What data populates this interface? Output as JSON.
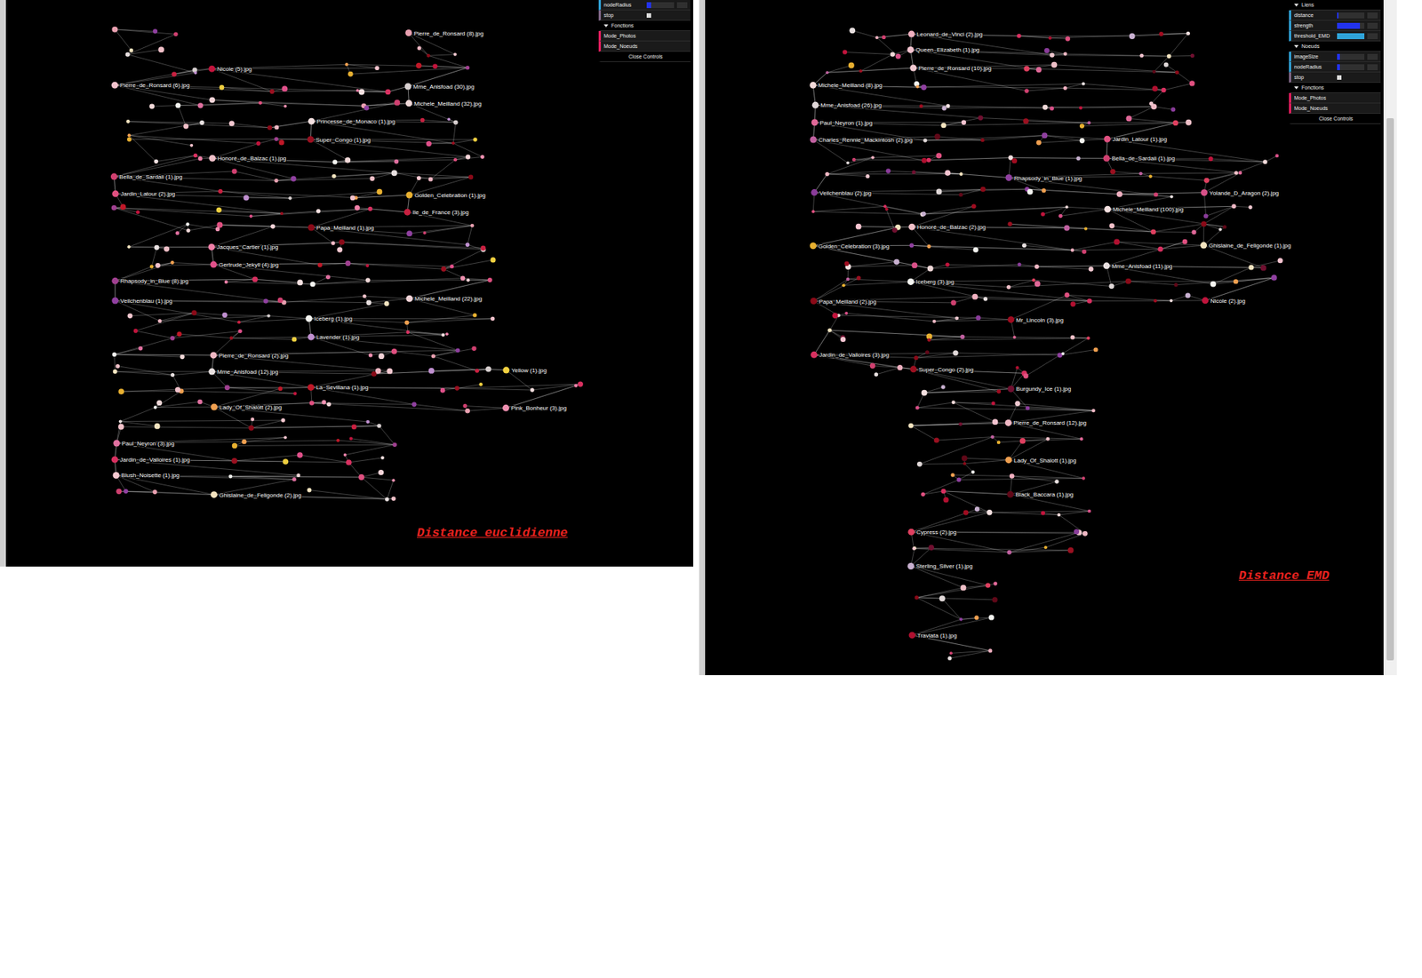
{
  "panels": [
    {
      "caption": "Distance euclidienne",
      "controls": [
        {
          "kind": "slider",
          "label": "nodeRadius",
          "level": 0.15,
          "color": "#2233ee"
        },
        {
          "kind": "checkbox",
          "label": "stop",
          "checked": false
        },
        {
          "kind": "folder",
          "label": "Fonctions",
          "expanded": true
        },
        {
          "kind": "button",
          "label": "Mode_Photos"
        },
        {
          "kind": "button",
          "label": "Mode_Noeuds"
        },
        {
          "kind": "close",
          "label": "Close Controls"
        }
      ],
      "scroll_level": null,
      "nodes": [
        {
          "label": "Pierre_de_Ronsard (8).jpg",
          "color": "#e9a0b0"
        },
        {
          "label": "Nicole (5).jpg",
          "color": "#c0143c"
        },
        {
          "label": "Pierre_de_Ronsard (6).jpg",
          "color": "#f2c2cc"
        },
        {
          "label": "Mme_Anisfoad (30).jpg",
          "color": "#d8d0d0"
        },
        {
          "label": "Michele_Meilland (32).jpg",
          "color": "#f0d8d8"
        },
        {
          "label": "Princesse_de_Monaco (1).jpg",
          "color": "#f4e0e0"
        },
        {
          "label": "Super_Congo (1).jpg",
          "color": "#9a1020"
        },
        {
          "label": "Honoré_de_Balzac (1).jpg",
          "color": "#f0c0c8"
        },
        {
          "label": "Bella_de_Sardaii (1).jpg",
          "color": "#d04070"
        },
        {
          "label": "Jardin_Latour (2).jpg",
          "color": "#e05080"
        },
        {
          "label": "Golden_Celebration (1).jpg",
          "color": "#e8b030"
        },
        {
          "label": "Ile_de_France (3).jpg",
          "color": "#c82040"
        },
        {
          "label": "Papa_Meilland (1).jpg",
          "color": "#8a0a18"
        },
        {
          "label": "Jacques_Cartier (1).jpg",
          "color": "#f080a8"
        },
        {
          "label": "Gertrude_Jekyll (4).jpg",
          "color": "#e0508a"
        },
        {
          "label": "Rhapsody_in_Blue (8).jpg",
          "color": "#a04090"
        },
        {
          "label": "Veilchenblau (1).jpg",
          "color": "#9040a0"
        },
        {
          "label": "Michele_Meilland (22).jpg",
          "color": "#f4d4d8"
        },
        {
          "label": "Iceberg (1).jpg",
          "color": "#f4f4f0"
        },
        {
          "label": "Lavender (1).jpg",
          "color": "#c090d0"
        },
        {
          "label": "Pierre_de_Ronsard (2).jpg",
          "color": "#f0b8c4"
        },
        {
          "label": "Mme_Anisfoad (12).jpg",
          "color": "#e8e0e0"
        },
        {
          "label": "Yellow (1).jpg",
          "color": "#f0d040"
        },
        {
          "label": "La_Sevillana (1).jpg",
          "color": "#c01828"
        },
        {
          "label": "Lady_Of_Shalott (2).jpg",
          "color": "#f0a050"
        },
        {
          "label": "Pink_Bonheur (3).jpg",
          "color": "#f090b0"
        },
        {
          "label": "Paul_Neyron (3).jpg",
          "color": "#e070a0"
        },
        {
          "label": "Jardin_de_Valloires (1).jpg",
          "color": "#d83060"
        },
        {
          "label": "Blush_Noisette (1).jpg",
          "color": "#f4c8d0"
        },
        {
          "label": "Ghislaine_de_Feligonde (2).jpg",
          "color": "#f4e4c0"
        }
      ]
    },
    {
      "caption": "Distance EMD",
      "controls": [
        {
          "kind": "folder",
          "label": "Liens",
          "expanded": true
        },
        {
          "kind": "slider",
          "label": "distance",
          "level": 0.05,
          "color": "#2233ee"
        },
        {
          "kind": "slider",
          "label": "strength",
          "level": 0.85,
          "color": "#2233ee"
        },
        {
          "kind": "slider",
          "label": "threshold_EMD",
          "level": 1.0,
          "color": "#2fa3d8"
        },
        {
          "kind": "folder",
          "label": "Noeuds",
          "expanded": true
        },
        {
          "kind": "slider",
          "label": "imageSize",
          "level": 0.12,
          "color": "#2233ee"
        },
        {
          "kind": "slider",
          "label": "nodeRadius",
          "level": 0.12,
          "color": "#2233ee"
        },
        {
          "kind": "checkbox",
          "label": "stop",
          "checked": false
        },
        {
          "kind": "folder",
          "label": "Fonctions",
          "expanded": true
        },
        {
          "kind": "button",
          "label": "Mode_Photos"
        },
        {
          "kind": "button",
          "label": "Mode_Noeuds"
        },
        {
          "kind": "close",
          "label": "Close Controls"
        }
      ],
      "scroll_level": 0.82,
      "nodes": [
        {
          "label": "Leonard_de_Vinci (2).jpg",
          "color": "#f0b0c0"
        },
        {
          "label": "Queen_Elizabeth (1).jpg",
          "color": "#f4c4d0"
        },
        {
          "label": "Pierre_de_Ronsard (10).jpg",
          "color": "#f0c8d0"
        },
        {
          "label": "Michele_Meilland (8).jpg",
          "color": "#f0d8d8"
        },
        {
          "label": "Mme_Anisfoad (26).jpg",
          "color": "#e0d8d8"
        },
        {
          "label": "Paul_Neyron (1).jpg",
          "color": "#e06898"
        },
        {
          "label": "Charles_Rennie_Mackintosh (2).jpg",
          "color": "#c060a0"
        },
        {
          "label": "Jardin_Latour (1).jpg",
          "color": "#e05080"
        },
        {
          "label": "Bella_de_Sardaii (1).jpg",
          "color": "#d04070"
        },
        {
          "label": "Rhapsody_in_Blue (1).jpg",
          "color": "#9040a0"
        },
        {
          "label": "Veilchenblau (2).jpg",
          "color": "#8a3c9a"
        },
        {
          "label": "Yolande_D_Aragon (2).jpg",
          "color": "#d85088"
        },
        {
          "label": "Michele_Meilland (100).jpg",
          "color": "#f4e0e0"
        },
        {
          "label": "Honoré_de_Balzac (2).jpg",
          "color": "#f0c0c8"
        },
        {
          "label": "Golden_Celebration (3).jpg",
          "color": "#e8b030"
        },
        {
          "label": "Ghislaine_de_Feligonde (1).jpg",
          "color": "#f4e4c0"
        },
        {
          "label": "Mme_Anisfoad (11).jpg",
          "color": "#e8e0e0"
        },
        {
          "label": "Iceberg (3).jpg",
          "color": "#f4f4f0"
        },
        {
          "label": "Papa_Meilland (2).jpg",
          "color": "#8a0a18"
        },
        {
          "label": "Nicole (2).jpg",
          "color": "#c0143c"
        },
        {
          "label": "Mr_Lincoln (3).jpg",
          "color": "#a00c20"
        },
        {
          "label": "Jardin_de_Valloires (3).jpg",
          "color": "#d83060"
        },
        {
          "label": "Super_Congo (2).jpg",
          "color": "#9a1020"
        },
        {
          "label": "Burgundy_Ice (1).jpg",
          "color": "#701030"
        },
        {
          "label": "Pierre_de_Ronsard (12).jpg",
          "color": "#f0b8c4"
        },
        {
          "label": "Lady_Of_Shalott (1).jpg",
          "color": "#f0a050"
        },
        {
          "label": "Black_Baccara (1).jpg",
          "color": "#600818"
        },
        {
          "label": "Cypress (2).jpg",
          "color": "#e04060"
        },
        {
          "label": "Sterling_Silver (1).jpg",
          "color": "#c8b0d0"
        },
        {
          "label": "Traviata (1).jpg",
          "color": "#b01030"
        }
      ]
    }
  ]
}
